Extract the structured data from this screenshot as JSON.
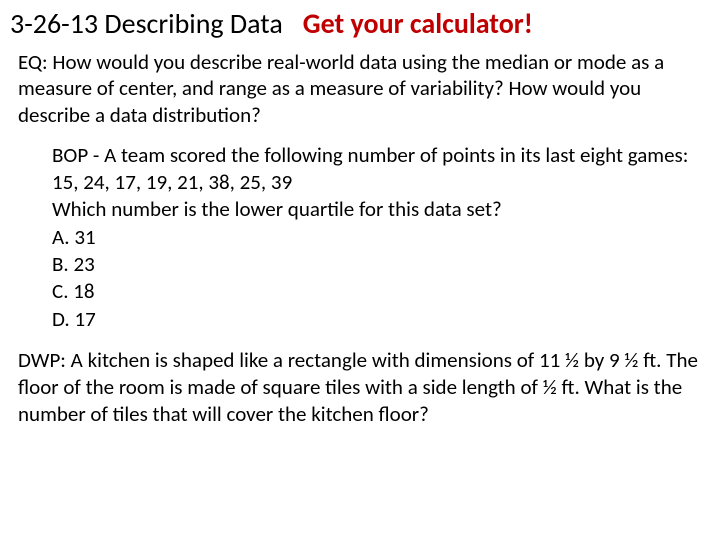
{
  "header": {
    "title_left": "3-26-13 Describing Data",
    "title_right": "Get your calculator!"
  },
  "eq": {
    "text": "EQ:  How would you describe real-world data using the median or mode as a measure of center, and range as a measure of variability?  How would you describe a data distribution?"
  },
  "bop": {
    "intro": "BOP   - A team scored the following number of points in its last eight games:  15, 24, 17, 19, 21, 38, 25, 39",
    "question": "Which number is the lower quartile for this data set?",
    "options": {
      "a": "A. 31",
      "b": "B. 23",
      "c": "C. 18",
      "d": "D. 17"
    }
  },
  "dwp": {
    "text": "DWP:  A kitchen is shaped like a rectangle with dimensions of  11 ½  by 9 ½  ft. The floor of the room is made of square tiles with a side length of ½ ft.  What is the number of tiles that will cover the kitchen floor?"
  }
}
